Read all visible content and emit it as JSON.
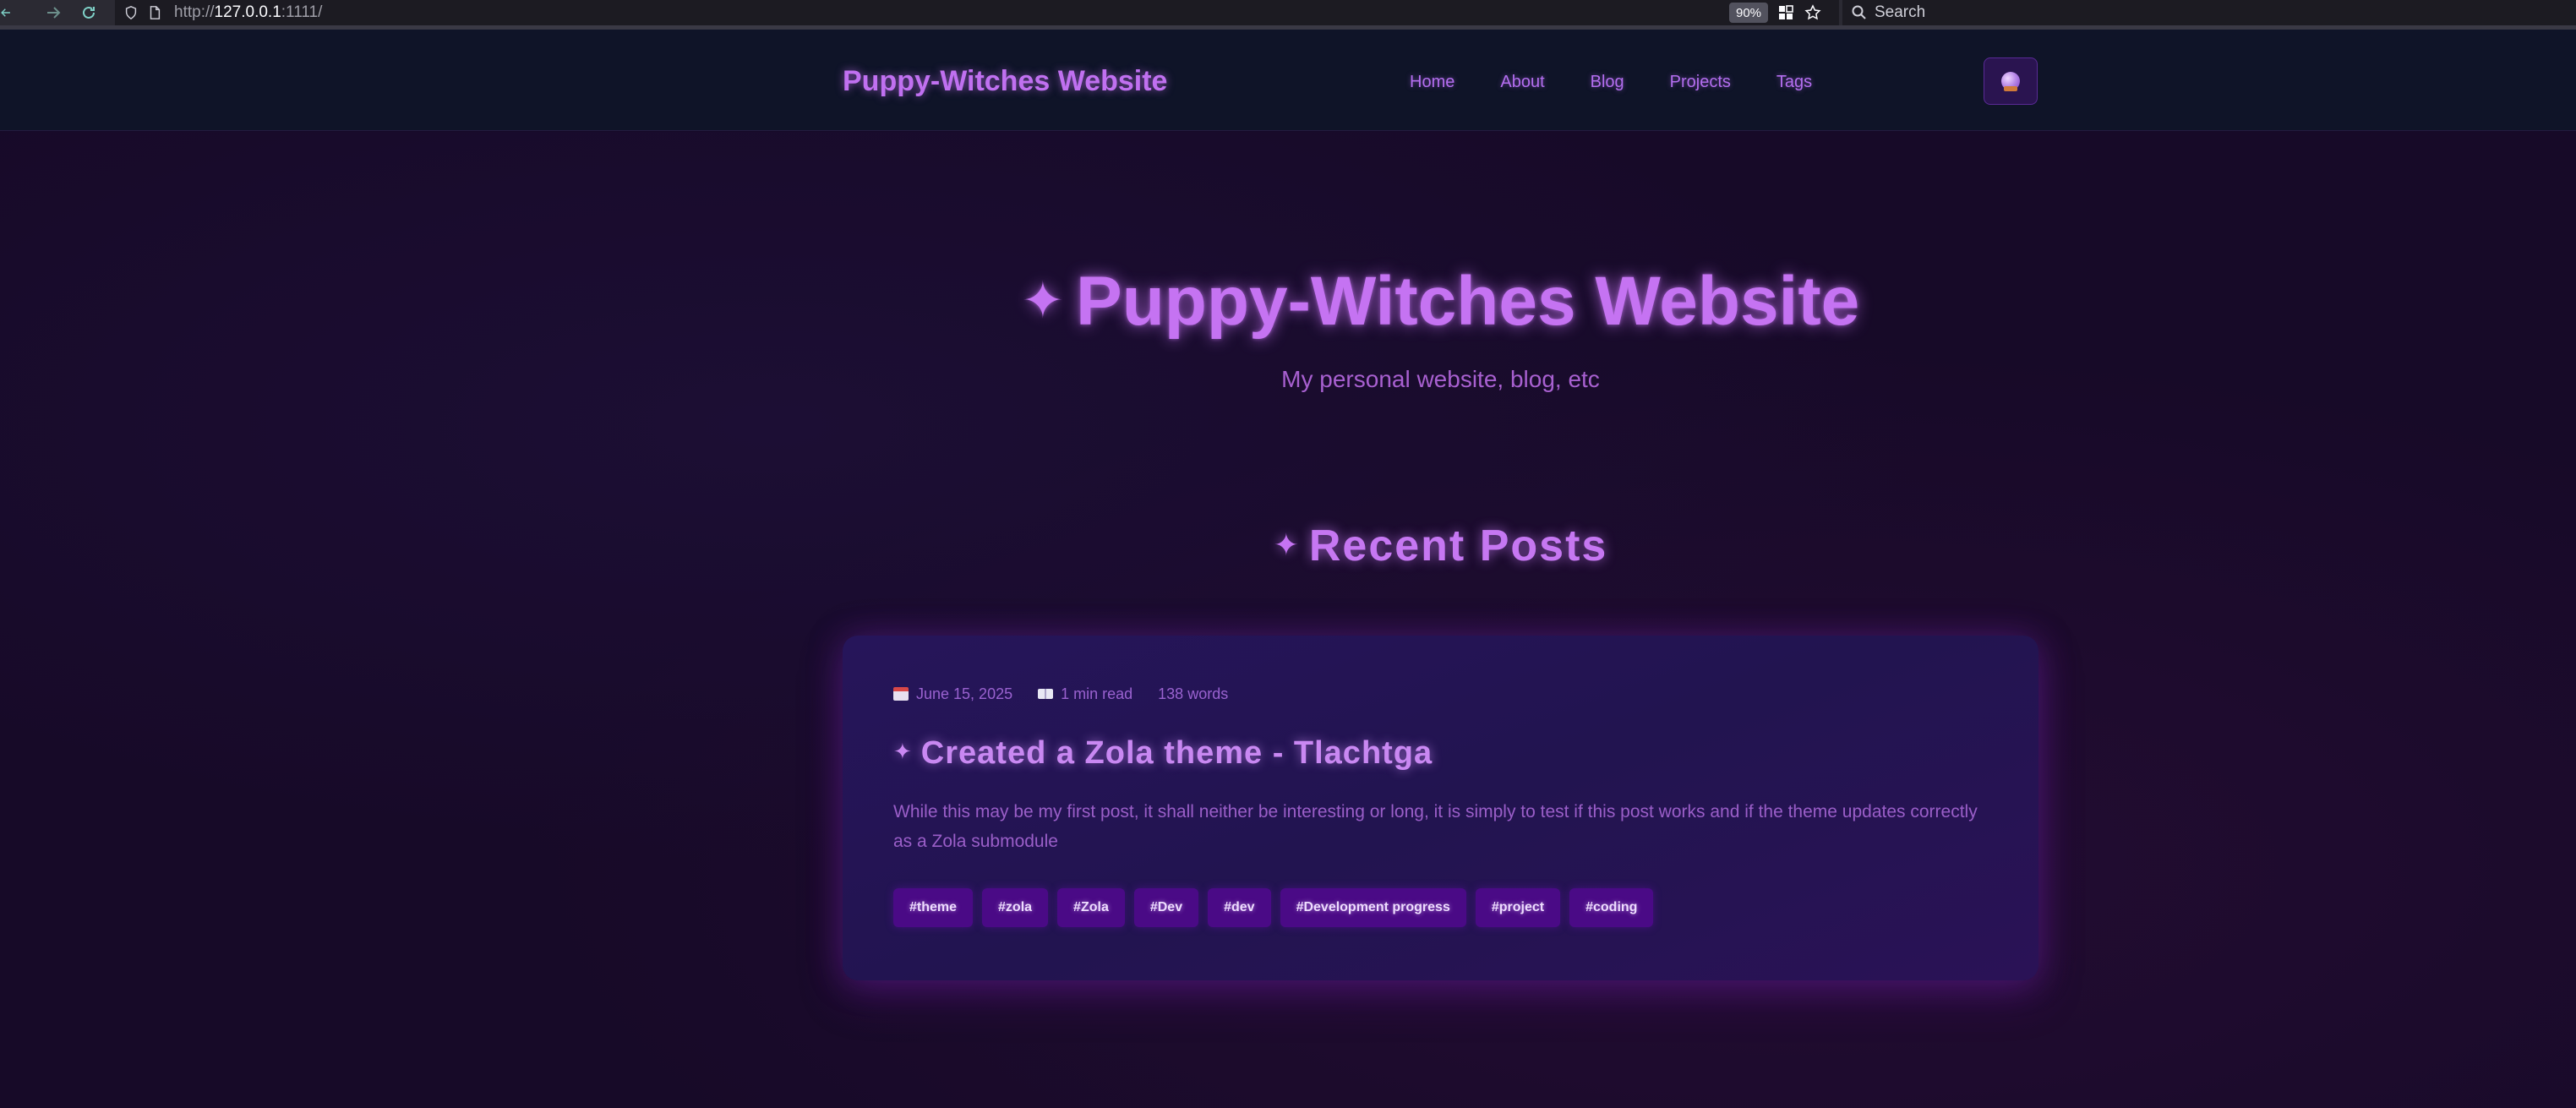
{
  "browser": {
    "url_scheme": "http://",
    "url_host": "127.0.0.1",
    "url_rest": ":1111/",
    "zoom": "90%",
    "search_placeholder": "Search"
  },
  "header": {
    "logo": "Puppy-Witches Website",
    "nav": [
      "Home",
      "About",
      "Blog",
      "Projects",
      "Tags"
    ],
    "theme_toggle_icon": "crystal-ball-icon"
  },
  "hero": {
    "sparkle": "✦",
    "title": "Puppy-Witches Website",
    "subtitle": "My personal website, blog, etc"
  },
  "recent": {
    "sparkle": "✦",
    "heading": "Recent Posts"
  },
  "post": {
    "date": "June 15, 2025",
    "read_time": "1 min read",
    "words": "138 words",
    "sparkle": "✦",
    "title": "Created a Zola theme - Tlachtga",
    "excerpt": "While this may be my first post, it shall neither be interesting or long, it is simply to test if this post works and if the theme updates correctly as a Zola submodule",
    "tags": [
      "#theme",
      "#zola",
      "#Zola",
      "#Dev",
      "#dev",
      "#Development progress",
      "#project",
      "#coding"
    ]
  },
  "colors": {
    "accent": "#c573f2",
    "header_bg": "#0f1428",
    "page_bg": "#170a28",
    "card_bg": "#231452",
    "tag_bg": "#4a0a86"
  }
}
